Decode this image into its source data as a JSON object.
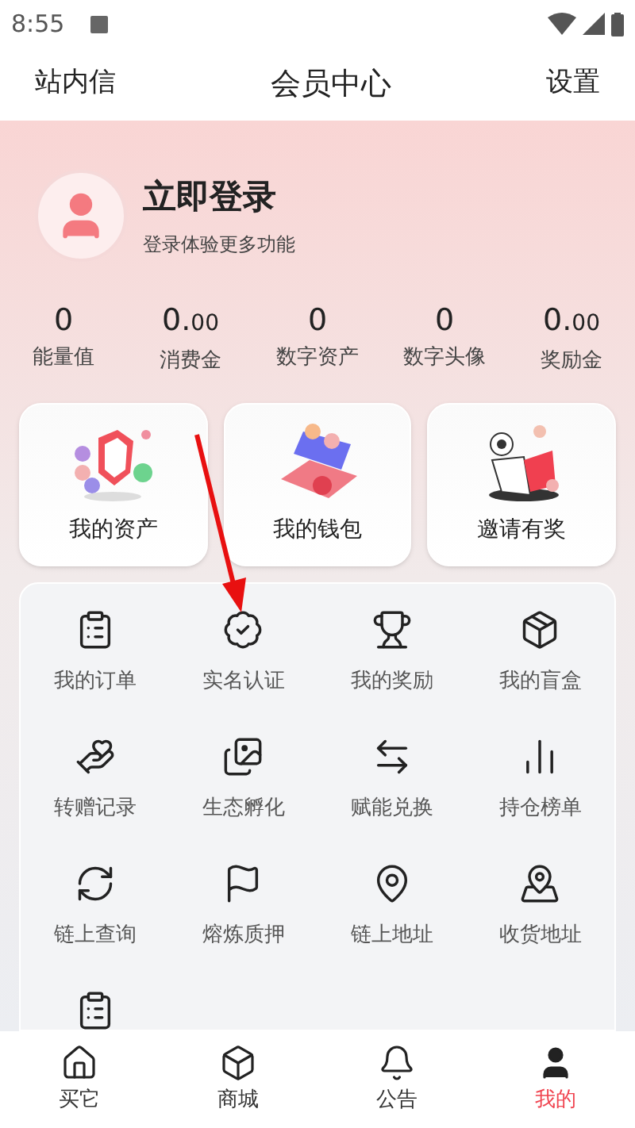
{
  "status_bar": {
    "time": "8:55"
  },
  "header": {
    "left": "站内信",
    "title": "会员中心",
    "right": "设置"
  },
  "profile": {
    "title": "立即登录",
    "subtitle": "登录体验更多功能"
  },
  "stats": [
    {
      "value": "0",
      "label": "能量值"
    },
    {
      "value": "0.",
      "fraction": "00",
      "label": "消费金"
    },
    {
      "value": "0",
      "label": "数字资产"
    },
    {
      "value": "0",
      "label": "数字头像"
    },
    {
      "value": "0.",
      "fraction": "00",
      "label": "奖励金"
    }
  ],
  "cards": [
    {
      "kind": "assets",
      "label": "我的资产"
    },
    {
      "kind": "wallet",
      "label": "我的钱包"
    },
    {
      "kind": "invite",
      "label": "邀请有奖"
    }
  ],
  "services": [
    {
      "kind": "order",
      "label": "我的订单"
    },
    {
      "kind": "verify",
      "label": "实名认证"
    },
    {
      "kind": "trophy",
      "label": "我的奖励"
    },
    {
      "kind": "box",
      "label": "我的盲盒"
    },
    {
      "kind": "gift",
      "label": "转赠记录"
    },
    {
      "kind": "layers",
      "label": "生态孵化"
    },
    {
      "kind": "exchange",
      "label": "赋能兑换"
    },
    {
      "kind": "rank",
      "label": "持仓榜单"
    },
    {
      "kind": "chain",
      "label": "链上查询"
    },
    {
      "kind": "flag",
      "label": "熔炼质押"
    },
    {
      "kind": "pin",
      "label": "链上地址"
    },
    {
      "kind": "location",
      "label": "收货地址"
    },
    {
      "kind": "order"
    }
  ],
  "nav": [
    {
      "kind": "home",
      "label": "买它",
      "selected": false
    },
    {
      "kind": "box",
      "label": "商城",
      "selected": false
    },
    {
      "kind": "bell",
      "label": "公告",
      "selected": false
    },
    {
      "kind": "user",
      "label": "我的",
      "selected": true
    }
  ]
}
